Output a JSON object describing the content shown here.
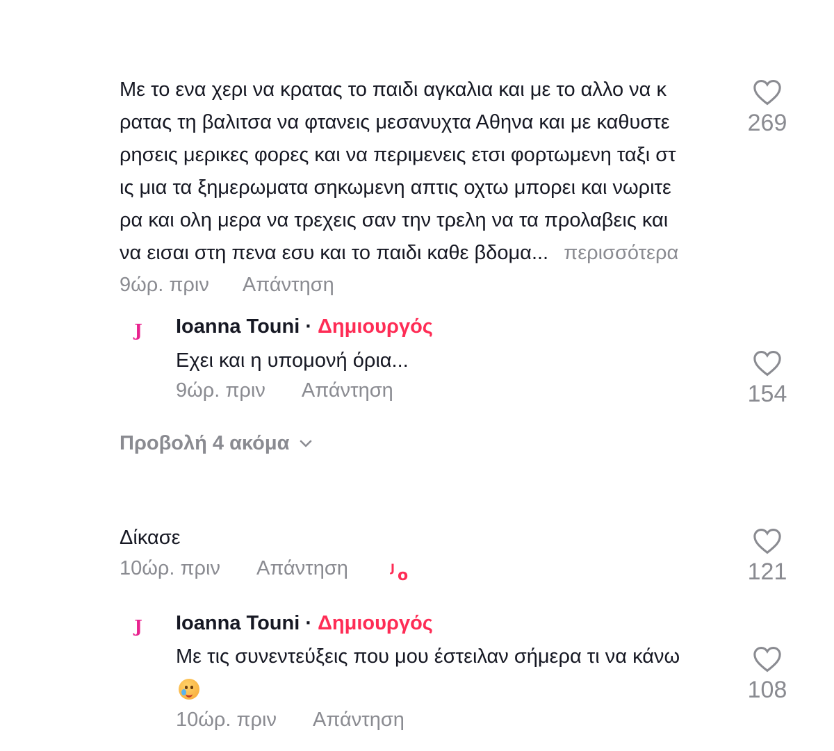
{
  "comments": [
    {
      "lines": [
        "Με το ενα χερι να κρατας το παιδι αγκαλια και με το αλλο να κ",
        "ρατας τη βαλιτσα να φτανεις μεσανυχτα Αθηνα και με καθυστε",
        "ρησεις μερικες φορες και να περιμενεις ετσι φορτωμενη ταξι στ",
        "ις μια τα ξημερωματα σηκωμενη απτις οχτω μπορει και νωριτε",
        "ρα και ολη μερα να τρεχεις σαν την τρελη να τα προλαβεις και",
        "να εισαι στη πενα εσυ και το παιδι καθε βδομα..."
      ],
      "more_label": "περισσότερα",
      "time": "9ώρ. πριν",
      "reply_label": "Απάντηση",
      "likes": "269",
      "reply": {
        "avatar_letter": "J",
        "author": "Ioanna Touni",
        "separator": " · ",
        "creator_label": "Δημιουργός",
        "text": "Εχει και η υπομονή όρια...",
        "time": "9ώρ. πριν",
        "reply_label": "Απάντηση",
        "likes": "154"
      },
      "view_more_label": "Προβολή 4 ακόμα"
    },
    {
      "text": "Δίκασε",
      "time": "10ώρ. πριν",
      "reply_label": "Απάντηση",
      "creator_liked_badge": "Jo",
      "likes": "121",
      "reply": {
        "avatar_letter": "J",
        "author": "Ioanna Touni",
        "separator": " · ",
        "creator_label": "Δημιουργός",
        "text": "Με τις συνεντεύξεις που μου έστειλαν σήμερα τι να κάνω",
        "emoji": "face-holding-back-tears-emoji",
        "time": "10ώρ. πριν",
        "reply_label": "Απάντηση",
        "likes": "108"
      }
    }
  ],
  "icons": {
    "like": "heart-outline-icon",
    "expand": "chevron-down-icon"
  },
  "colors": {
    "creator": "#fe2c55",
    "meta": "#8a8b91",
    "text": "#161823",
    "avatar": "#e8238f"
  }
}
